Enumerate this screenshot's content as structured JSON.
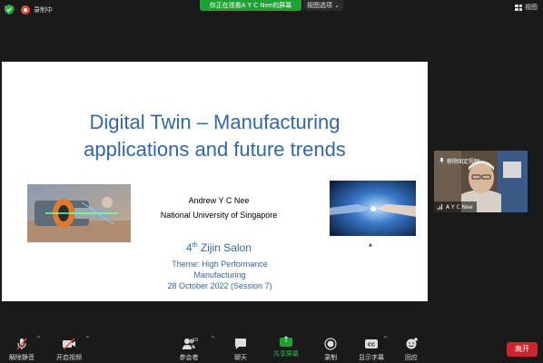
{
  "topbar": {
    "recording_label": "录制中",
    "share_banner": "你正在观看A Y C Nee的屏幕",
    "view_options": "视图选项 ⌄",
    "view_label": "视图"
  },
  "slide": {
    "title_line1": "Digital Twin – Manufacturing",
    "title_line2": "applications and future trends",
    "author_name": "Andrew Y C Nee",
    "author_affiliation": "National University of Singapore",
    "salon_number": "4",
    "salon_suffix": "th",
    "salon_name": " Zijin Salon",
    "theme_line1": "Theme: High Performance",
    "theme_line2": "Manufacturing",
    "date_line": "28 October 2022 (Session 7)"
  },
  "video": {
    "pin_label": "移除固定视频",
    "participant_name": "A Y C Nee"
  },
  "toolbar": {
    "unmute": "解除静音",
    "start_video": "开启视频",
    "participants": "参会者",
    "participants_count": "10",
    "chat": "聊天",
    "share": "共享屏幕",
    "record": "录制",
    "captions": "显示字幕",
    "reactions": "回应",
    "leave": "离开"
  },
  "colors": {
    "accent_green": "#21a036",
    "leave_red": "#c8282d",
    "title_blue": "#3467a8",
    "record_red": "#e44b3c"
  }
}
